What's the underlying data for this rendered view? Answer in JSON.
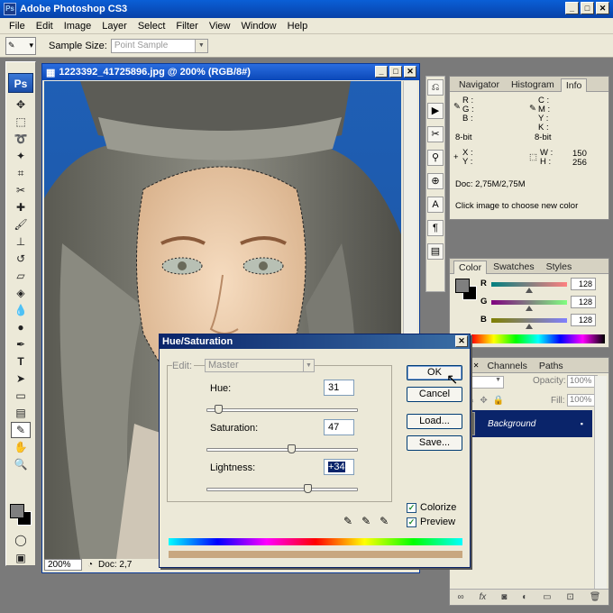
{
  "app": {
    "title": "Adobe Photoshop CS3",
    "logo": "Ps"
  },
  "menu": [
    "File",
    "Edit",
    "Image",
    "Layer",
    "Select",
    "Filter",
    "View",
    "Window",
    "Help"
  ],
  "options": {
    "sample_size_label": "Sample Size:",
    "sample_size_value": "Point Sample"
  },
  "document": {
    "title": "1223392_41725896.jpg @ 200% (RGB/8#)",
    "zoom": "200%",
    "status": "Doc: 2,7"
  },
  "info_panel": {
    "tabs": [
      "Navigator",
      "Histogram",
      "Info"
    ],
    "rgb": "R :\nG :\nB :",
    "cmyk": "C :\nM :\nY :\nK :",
    "bit_left": "8-bit",
    "bit_right": "8-bit",
    "xy": "X :\nY :",
    "wh_labels": "W :\nH :",
    "w": "150",
    "h": "256",
    "doc": "Doc: 2,75M/2,75M",
    "hint": "Click image to choose new color"
  },
  "color_panel": {
    "tabs": [
      "Color",
      "Swatches",
      "Styles"
    ],
    "channels": [
      {
        "label": "R",
        "value": "128"
      },
      {
        "label": "G",
        "value": "128"
      },
      {
        "label": "B",
        "value": "128"
      }
    ]
  },
  "layers_panel": {
    "tabs": [
      "rs",
      "Channels",
      "Paths"
    ],
    "blend": "al",
    "opacity_label": "Opacity:",
    "opacity": "100%",
    "fill_label": "Fill:",
    "fill": "100%",
    "layer_name": "Background"
  },
  "dialog": {
    "title": "Hue/Saturation",
    "edit_label": "Edit:",
    "edit_value": "Master",
    "hue_label": "Hue:",
    "hue": "31",
    "hue_level": 0.08,
    "saturation_label": "Saturation:",
    "saturation": "47",
    "saturation_level": 0.56,
    "lightness_label": "Lightness:",
    "lightness": "+34",
    "lightness_level": 0.67,
    "ok": "OK",
    "cancel": "Cancel",
    "load": "Load...",
    "save": "Save...",
    "colorize": "Colorize",
    "preview": "Preview"
  }
}
